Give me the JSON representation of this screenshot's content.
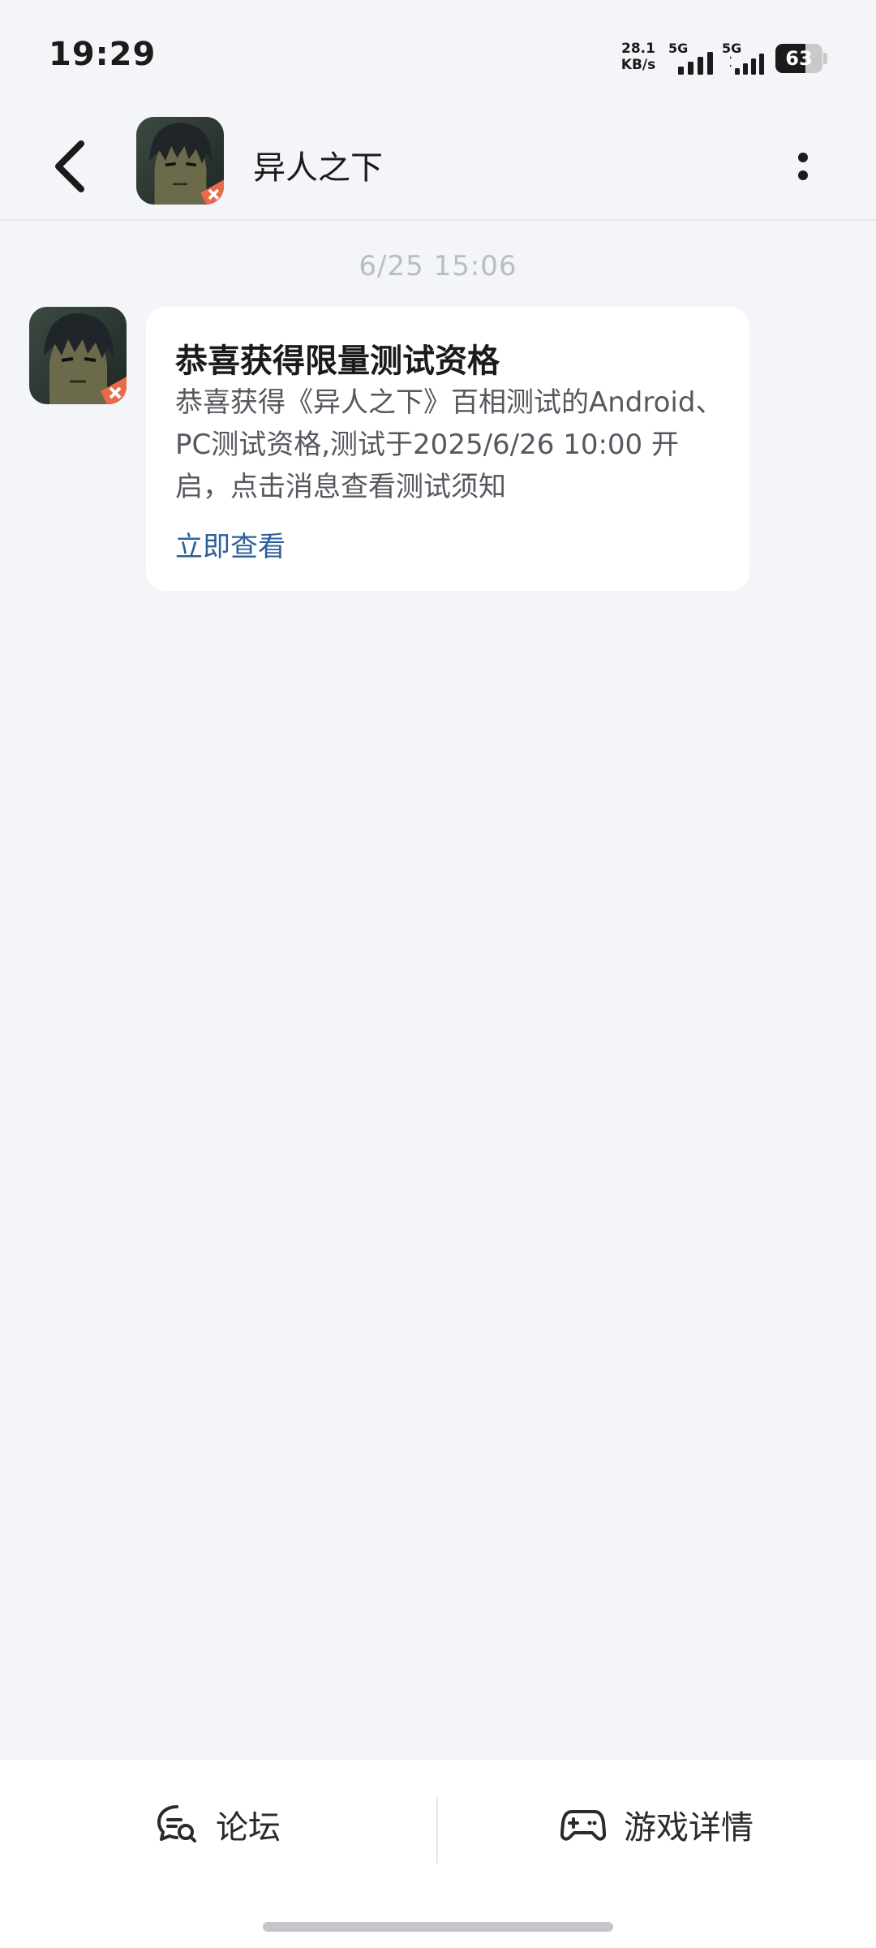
{
  "status_bar": {
    "time": "19:29",
    "net_speed_value": "28.1",
    "net_speed_unit": "KB/s",
    "sim1_label": "5G",
    "sim2_label": "5G",
    "battery_level": "63"
  },
  "header": {
    "back_icon": "chevron-left-icon",
    "avatar_icon": "game-avatar",
    "title": "异人之下",
    "more_icon": "vertical-dots-icon"
  },
  "chat": {
    "timestamp": "6/25  15:06",
    "message": {
      "title": "恭喜获得限量测试资格",
      "body": "恭喜获得《异人之下》百相测试的Android、PC测试资格,测试于2025/6/26 10:00 开启，点击消息查看测试须知",
      "link": "立即查看"
    }
  },
  "bottom_bar": {
    "forum_icon": "chat-search-icon",
    "forum_label": "论坛",
    "details_icon": "gamepad-icon",
    "details_label": "游戏详情"
  },
  "colors": {
    "background": "#f4f5f8",
    "link": "#2e5f99",
    "timestamp": "#b8bcc4"
  }
}
